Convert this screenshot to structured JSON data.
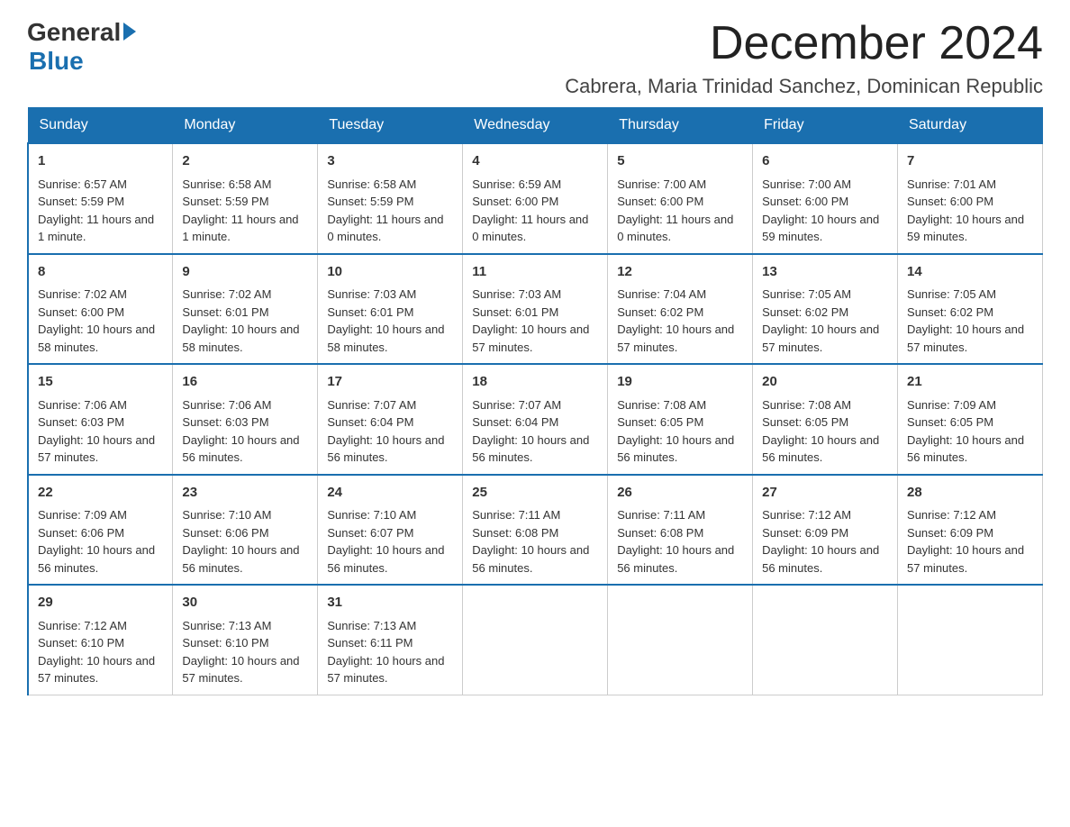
{
  "header": {
    "logo_general": "General",
    "logo_blue": "Blue",
    "month_title": "December 2024",
    "location": "Cabrera, Maria Trinidad Sanchez, Dominican Republic"
  },
  "days_of_week": [
    "Sunday",
    "Monday",
    "Tuesday",
    "Wednesday",
    "Thursday",
    "Friday",
    "Saturday"
  ],
  "weeks": [
    [
      {
        "day": "1",
        "sunrise": "6:57 AM",
        "sunset": "5:59 PM",
        "daylight": "11 hours and 1 minute."
      },
      {
        "day": "2",
        "sunrise": "6:58 AM",
        "sunset": "5:59 PM",
        "daylight": "11 hours and 1 minute."
      },
      {
        "day": "3",
        "sunrise": "6:58 AM",
        "sunset": "5:59 PM",
        "daylight": "11 hours and 0 minutes."
      },
      {
        "day": "4",
        "sunrise": "6:59 AM",
        "sunset": "6:00 PM",
        "daylight": "11 hours and 0 minutes."
      },
      {
        "day": "5",
        "sunrise": "7:00 AM",
        "sunset": "6:00 PM",
        "daylight": "11 hours and 0 minutes."
      },
      {
        "day": "6",
        "sunrise": "7:00 AM",
        "sunset": "6:00 PM",
        "daylight": "10 hours and 59 minutes."
      },
      {
        "day": "7",
        "sunrise": "7:01 AM",
        "sunset": "6:00 PM",
        "daylight": "10 hours and 59 minutes."
      }
    ],
    [
      {
        "day": "8",
        "sunrise": "7:02 AM",
        "sunset": "6:00 PM",
        "daylight": "10 hours and 58 minutes."
      },
      {
        "day": "9",
        "sunrise": "7:02 AM",
        "sunset": "6:01 PM",
        "daylight": "10 hours and 58 minutes."
      },
      {
        "day": "10",
        "sunrise": "7:03 AM",
        "sunset": "6:01 PM",
        "daylight": "10 hours and 58 minutes."
      },
      {
        "day": "11",
        "sunrise": "7:03 AM",
        "sunset": "6:01 PM",
        "daylight": "10 hours and 57 minutes."
      },
      {
        "day": "12",
        "sunrise": "7:04 AM",
        "sunset": "6:02 PM",
        "daylight": "10 hours and 57 minutes."
      },
      {
        "day": "13",
        "sunrise": "7:05 AM",
        "sunset": "6:02 PM",
        "daylight": "10 hours and 57 minutes."
      },
      {
        "day": "14",
        "sunrise": "7:05 AM",
        "sunset": "6:02 PM",
        "daylight": "10 hours and 57 minutes."
      }
    ],
    [
      {
        "day": "15",
        "sunrise": "7:06 AM",
        "sunset": "6:03 PM",
        "daylight": "10 hours and 57 minutes."
      },
      {
        "day": "16",
        "sunrise": "7:06 AM",
        "sunset": "6:03 PM",
        "daylight": "10 hours and 56 minutes."
      },
      {
        "day": "17",
        "sunrise": "7:07 AM",
        "sunset": "6:04 PM",
        "daylight": "10 hours and 56 minutes."
      },
      {
        "day": "18",
        "sunrise": "7:07 AM",
        "sunset": "6:04 PM",
        "daylight": "10 hours and 56 minutes."
      },
      {
        "day": "19",
        "sunrise": "7:08 AM",
        "sunset": "6:05 PM",
        "daylight": "10 hours and 56 minutes."
      },
      {
        "day": "20",
        "sunrise": "7:08 AM",
        "sunset": "6:05 PM",
        "daylight": "10 hours and 56 minutes."
      },
      {
        "day": "21",
        "sunrise": "7:09 AM",
        "sunset": "6:05 PM",
        "daylight": "10 hours and 56 minutes."
      }
    ],
    [
      {
        "day": "22",
        "sunrise": "7:09 AM",
        "sunset": "6:06 PM",
        "daylight": "10 hours and 56 minutes."
      },
      {
        "day": "23",
        "sunrise": "7:10 AM",
        "sunset": "6:06 PM",
        "daylight": "10 hours and 56 minutes."
      },
      {
        "day": "24",
        "sunrise": "7:10 AM",
        "sunset": "6:07 PM",
        "daylight": "10 hours and 56 minutes."
      },
      {
        "day": "25",
        "sunrise": "7:11 AM",
        "sunset": "6:08 PM",
        "daylight": "10 hours and 56 minutes."
      },
      {
        "day": "26",
        "sunrise": "7:11 AM",
        "sunset": "6:08 PM",
        "daylight": "10 hours and 56 minutes."
      },
      {
        "day": "27",
        "sunrise": "7:12 AM",
        "sunset": "6:09 PM",
        "daylight": "10 hours and 56 minutes."
      },
      {
        "day": "28",
        "sunrise": "7:12 AM",
        "sunset": "6:09 PM",
        "daylight": "10 hours and 57 minutes."
      }
    ],
    [
      {
        "day": "29",
        "sunrise": "7:12 AM",
        "sunset": "6:10 PM",
        "daylight": "10 hours and 57 minutes."
      },
      {
        "day": "30",
        "sunrise": "7:13 AM",
        "sunset": "6:10 PM",
        "daylight": "10 hours and 57 minutes."
      },
      {
        "day": "31",
        "sunrise": "7:13 AM",
        "sunset": "6:11 PM",
        "daylight": "10 hours and 57 minutes."
      },
      null,
      null,
      null,
      null
    ]
  ]
}
